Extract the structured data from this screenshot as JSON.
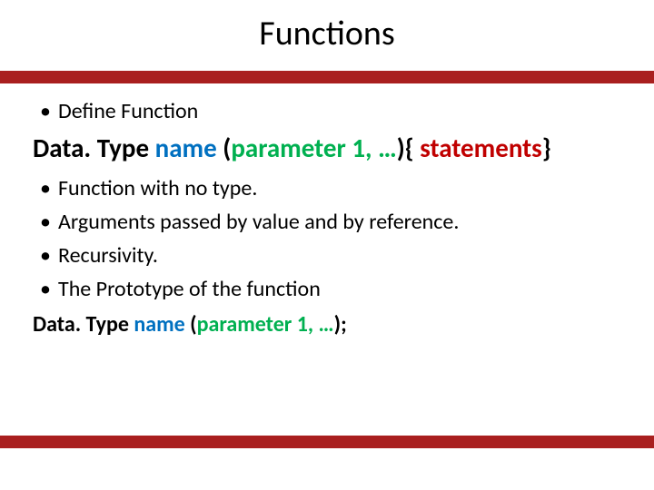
{
  "title": "Functions",
  "bullets_top": [
    "Define Function"
  ],
  "syntax1": {
    "datatype": "Data. Type",
    "name": " name ",
    "paren_open": "(",
    "param": "parameter 1, …",
    "paren_close": ")",
    "brace_open": "{",
    "stmts": " statements",
    "brace_close": "}"
  },
  "bullets_mid": [
    "Function with no type.",
    "Arguments passed by value and by reference.",
    "Recursivity.",
    "The Prototype of the function"
  ],
  "syntax2": {
    "datatype": "Data. Type",
    "name": " name ",
    "paren_open": "(",
    "param": "parameter 1, …",
    "paren_close_semi": ");"
  },
  "dot": "•"
}
